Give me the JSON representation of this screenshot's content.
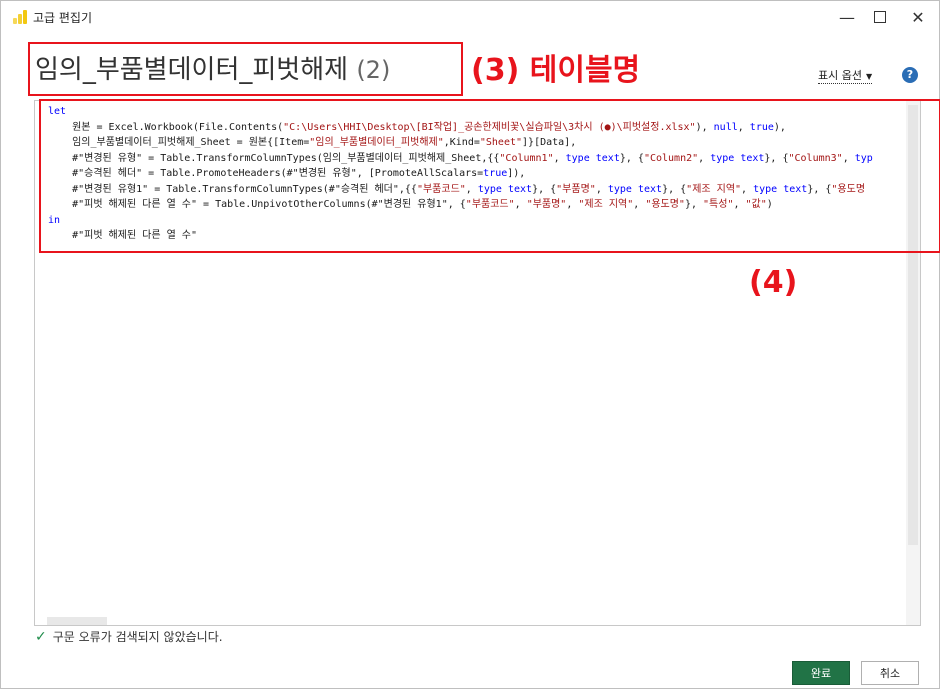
{
  "window": {
    "title": "고급 편집기",
    "minimize_glyph": "—",
    "close_glyph": "✕"
  },
  "query": {
    "name": "임의_부품별데이터_피벗해제",
    "suffix": "(2)"
  },
  "annotations": {
    "label3": "(3) 테이블명",
    "label4": "(4)",
    "color": "#e8141c"
  },
  "toolbar": {
    "display_options": "표시 옵션",
    "help": "?"
  },
  "code_lines": [
    [
      {
        "t": "let",
        "c": "kw"
      }
    ],
    [
      {
        "t": "    원본 = Excel.Workbook(File.Contents(",
        "c": ""
      },
      {
        "t": "\"C:\\Users\\HHI\\Desktop\\[BI작업]_공손한제비꽃\\실습파일\\3차시 (●)\\피벗설정.xlsx\"",
        "c": "str"
      },
      {
        "t": "), ",
        "c": ""
      },
      {
        "t": "null",
        "c": "kw"
      },
      {
        "t": ", ",
        "c": ""
      },
      {
        "t": "true",
        "c": "kw"
      },
      {
        "t": "),",
        "c": ""
      }
    ],
    [
      {
        "t": "    임의_부품별데이터_피벗해제_Sheet = 원본{[Item=",
        "c": ""
      },
      {
        "t": "\"임의_부품별데이터_피벗해제\"",
        "c": "str"
      },
      {
        "t": ",Kind=",
        "c": ""
      },
      {
        "t": "\"Sheet\"",
        "c": "str"
      },
      {
        "t": "]}[Data],",
        "c": ""
      }
    ],
    [
      {
        "t": "    #\"변경된 유형\" = Table.TransformColumnTypes(임의_부품별데이터_피벗해제_Sheet,{{",
        "c": ""
      },
      {
        "t": "\"Column1\"",
        "c": "str"
      },
      {
        "t": ", ",
        "c": ""
      },
      {
        "t": "type",
        "c": "kw"
      },
      {
        "t": " ",
        "c": ""
      },
      {
        "t": "text",
        "c": "kw"
      },
      {
        "t": "}, {",
        "c": ""
      },
      {
        "t": "\"Column2\"",
        "c": "str"
      },
      {
        "t": ", ",
        "c": ""
      },
      {
        "t": "type",
        "c": "kw"
      },
      {
        "t": " ",
        "c": ""
      },
      {
        "t": "text",
        "c": "kw"
      },
      {
        "t": "}, {",
        "c": ""
      },
      {
        "t": "\"Column3\"",
        "c": "str"
      },
      {
        "t": ", ",
        "c": ""
      },
      {
        "t": "typ",
        "c": "kw"
      }
    ],
    [
      {
        "t": "    #\"승격된 헤더\" = Table.PromoteHeaders(#\"변경된 유형\", [PromoteAllScalars=",
        "c": ""
      },
      {
        "t": "true",
        "c": "kw"
      },
      {
        "t": "]),",
        "c": ""
      }
    ],
    [
      {
        "t": "    #\"변경된 유형1\" = Table.TransformColumnTypes(#\"승격된 헤더\",{{",
        "c": ""
      },
      {
        "t": "\"부품코드\"",
        "c": "str"
      },
      {
        "t": ", ",
        "c": ""
      },
      {
        "t": "type",
        "c": "kw"
      },
      {
        "t": " ",
        "c": ""
      },
      {
        "t": "text",
        "c": "kw"
      },
      {
        "t": "}, {",
        "c": ""
      },
      {
        "t": "\"부품명\"",
        "c": "str"
      },
      {
        "t": ", ",
        "c": ""
      },
      {
        "t": "type",
        "c": "kw"
      },
      {
        "t": " ",
        "c": ""
      },
      {
        "t": "text",
        "c": "kw"
      },
      {
        "t": "}, {",
        "c": ""
      },
      {
        "t": "\"제조 지역\"",
        "c": "str"
      },
      {
        "t": ", ",
        "c": ""
      },
      {
        "t": "type",
        "c": "kw"
      },
      {
        "t": " ",
        "c": ""
      },
      {
        "t": "text",
        "c": "kw"
      },
      {
        "t": "}, {",
        "c": ""
      },
      {
        "t": "\"용도명",
        "c": "str"
      }
    ],
    [
      {
        "t": "    #\"피벗 해제된 다른 열 수\" = Table.UnpivotOtherColumns(#\"변경된 유형1\", {",
        "c": ""
      },
      {
        "t": "\"부품코드\"",
        "c": "str"
      },
      {
        "t": ", ",
        "c": ""
      },
      {
        "t": "\"부품명\"",
        "c": "str"
      },
      {
        "t": ", ",
        "c": ""
      },
      {
        "t": "\"제조 지역\"",
        "c": "str"
      },
      {
        "t": ", ",
        "c": ""
      },
      {
        "t": "\"용도명\"",
        "c": "str"
      },
      {
        "t": "}, ",
        "c": ""
      },
      {
        "t": "\"특성\"",
        "c": "str"
      },
      {
        "t": ", ",
        "c": ""
      },
      {
        "t": "\"값\"",
        "c": "str"
      },
      {
        "t": ")",
        "c": ""
      }
    ],
    [
      {
        "t": "in",
        "c": "kw"
      }
    ],
    [
      {
        "t": "    #\"피벗 해제된 다른 열 수\"",
        "c": ""
      }
    ]
  ],
  "status": {
    "check": "✓",
    "message": "구문 오류가 검색되지 않았습니다."
  },
  "buttons": {
    "done": "완료",
    "cancel": "취소"
  }
}
